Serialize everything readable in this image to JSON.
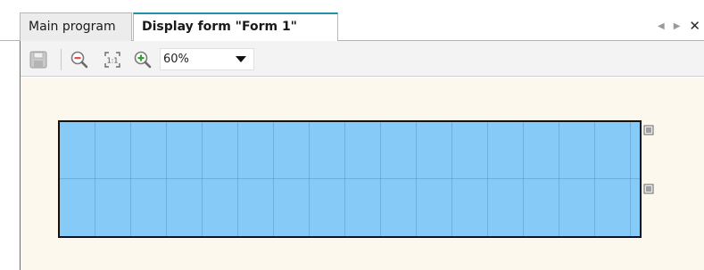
{
  "tabs": [
    {
      "label": "Main program",
      "active": false
    },
    {
      "label": "Display form \"Form 1\"",
      "active": true
    }
  ],
  "tab_controls": {
    "prev_icon": "triangle-left-icon",
    "next_icon": "triangle-right-icon",
    "close_icon": "close-icon",
    "prev_glyph": "◀",
    "next_glyph": "▶",
    "close_glyph": "✕"
  },
  "toolbar": {
    "save_icon": "floppy-disk-icon",
    "zoom_out_icon": "zoom-out-icon",
    "actual_size_icon": "actual-size-icon",
    "actual_size_label": "1:1",
    "zoom_in_icon": "zoom-in-icon",
    "zoom_value": "60%"
  },
  "canvas": {
    "background": "#fdf8ee",
    "form_fill": "#86cbf7",
    "form_border": "#111111",
    "row_icon": "row-handle-icon"
  },
  "colors": {
    "active_tab_accent": "#1e93a8",
    "zoom_out_red": "#d9534f",
    "zoom_in_green": "#3a9b3a"
  }
}
